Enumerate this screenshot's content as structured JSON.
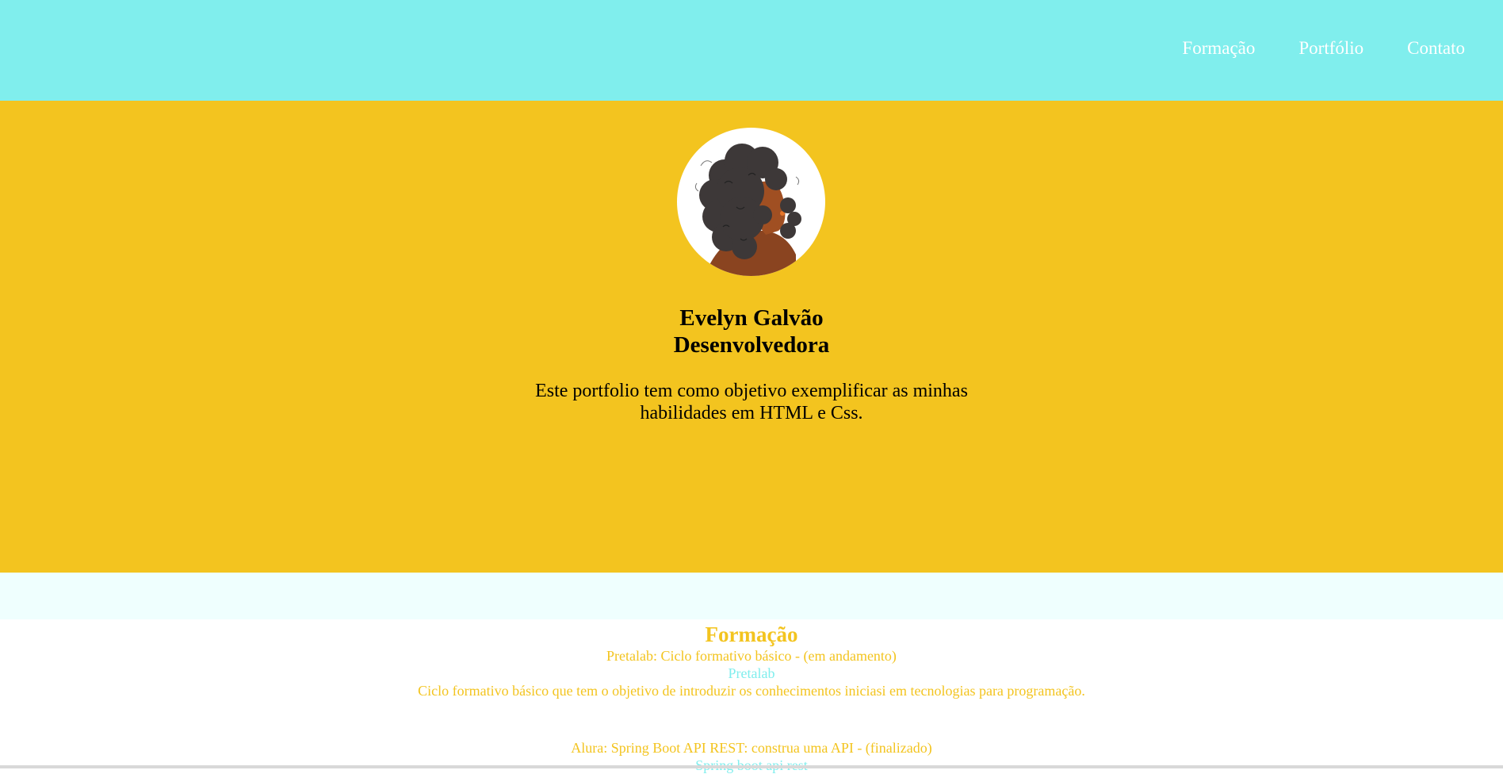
{
  "nav": {
    "items": [
      "Formação",
      "Portfólio",
      "Contato"
    ]
  },
  "hero": {
    "name": "Evelyn Galvão",
    "role": "Desenvolvedora",
    "description": "Este portfolio tem como objetivo exemplificar as minhas habilidades em HTML e Css."
  },
  "education": {
    "title": "Formação",
    "courses": [
      {
        "title": "Pretalab: Ciclo formativo básico - (em andamento)",
        "link": "Pretalab",
        "description": "Ciclo formativo básico que tem o objetivo de introduzir os conhecimentos iniciasi em tecnologias para programação."
      },
      {
        "title": "Alura: Spring Boot API REST: construa uma API - (finalizado)",
        "link": "Spring boot api rest"
      }
    ]
  },
  "colors": {
    "header": "#80eeed",
    "hero": "#f3c41f",
    "band": "#effffe",
    "accent_text": "#f3c41f",
    "link_text": "#80eeed"
  },
  "icons": {
    "avatar": "woman-curly-hair-avatar"
  }
}
